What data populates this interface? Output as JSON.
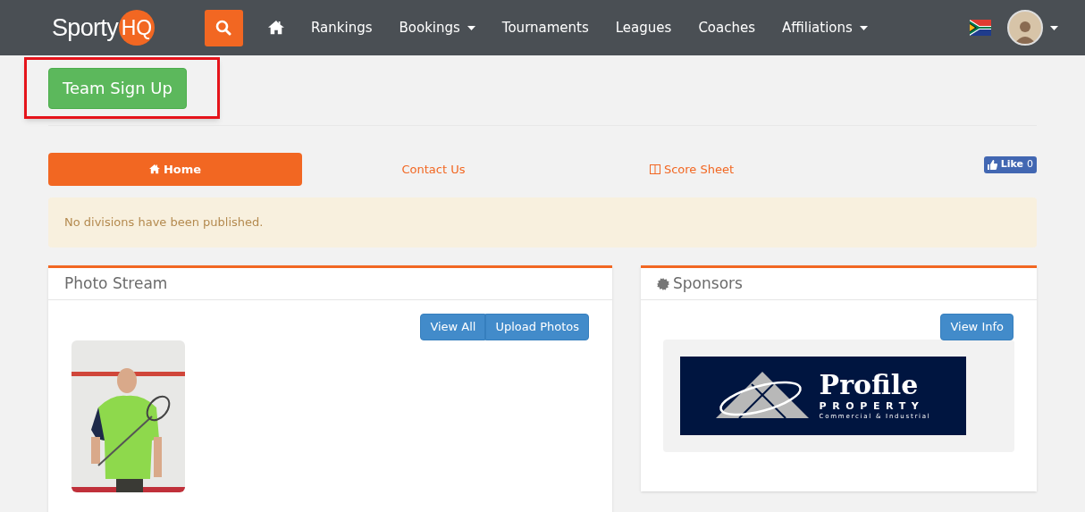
{
  "navbar": {
    "logo": {
      "word": "Sporty",
      "badge": "HQ"
    },
    "items": [
      {
        "kind": "home"
      },
      {
        "kind": "link",
        "label": "Rankings",
        "dropdown": false
      },
      {
        "kind": "link",
        "label": "Bookings",
        "dropdown": true
      },
      {
        "kind": "link",
        "label": "Tournaments",
        "dropdown": false
      },
      {
        "kind": "link",
        "label": "Leagues",
        "dropdown": false
      },
      {
        "kind": "link",
        "label": "Coaches",
        "dropdown": false
      },
      {
        "kind": "link",
        "label": "Affiliations",
        "dropdown": true
      }
    ]
  },
  "signup_button": {
    "label": "Team Sign Up",
    "highlighted": true
  },
  "tabs": [
    {
      "kind": "home",
      "label": "Home",
      "selected": true
    },
    {
      "kind": "plain",
      "label": "Contact Us",
      "selected": false
    },
    {
      "kind": "columns",
      "label": "Score Sheet",
      "selected": false
    }
  ],
  "like_button": {
    "label": "Like",
    "count": "0"
  },
  "alert": "No divisions have been published.",
  "photo_stream": {
    "title": "Photo Stream",
    "buttons": [
      "View All",
      "Upload Photos"
    ],
    "photos": [
      {
        "kind": "picture"
      }
    ]
  },
  "sponsors": {
    "title": "Sponsors",
    "button": "View Info",
    "logo": {
      "name": "Profile",
      "line": "PROPERTY",
      "tagline": "Commercial & Industrial"
    }
  }
}
